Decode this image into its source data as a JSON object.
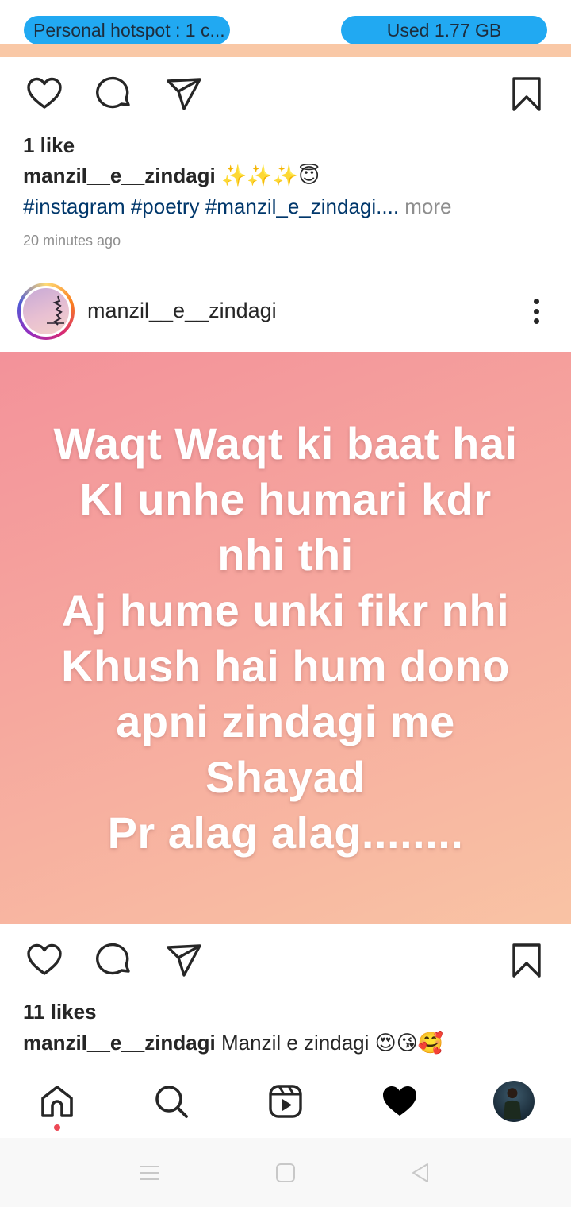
{
  "status_bar": {
    "hotspot_text": "Personal hotspot : 1 c...",
    "data_used_text": "Used  1.77 GB",
    "pill_color": "#21a9f2"
  },
  "post1": {
    "likes": "1 like",
    "caption_user": "manzil__e__zindagi",
    "caption_emojis": "✨✨✨😇",
    "hashtags": "#instagram #poetry #manzil_e_zindagi....",
    "more_label": " more",
    "time_ago": "20 minutes ago"
  },
  "post2": {
    "username": "manzil__e__zindagi",
    "image_text": [
      "Waqt Waqt ki baat hai",
      "Kl unhe humari kdr",
      "nhi thi",
      "Aj hume unki fikr nhi",
      "Khush hai hum dono",
      "apni zindagi me",
      "Shayad",
      "Pr alag alag........"
    ],
    "likes": "11 likes",
    "caption_user": "manzil__e__zindagi",
    "caption_text": " Manzil e zindagi ",
    "caption_emojis": "😍😘🥰"
  },
  "icons": {
    "like": "heart-outline-icon",
    "comment": "comment-icon",
    "share": "send-icon",
    "save": "bookmark-icon",
    "home": "home-icon",
    "search": "search-icon",
    "reels": "reels-icon",
    "activity": "heart-filled-icon",
    "options": "more-vertical-icon"
  },
  "colors": {
    "hashtag": "#00376b",
    "muted": "#8e8e8e",
    "notification_dot": "#ed4956",
    "post_image_gradient_start": "#f3929a",
    "post_image_gradient_end": "#f9c3a4"
  }
}
